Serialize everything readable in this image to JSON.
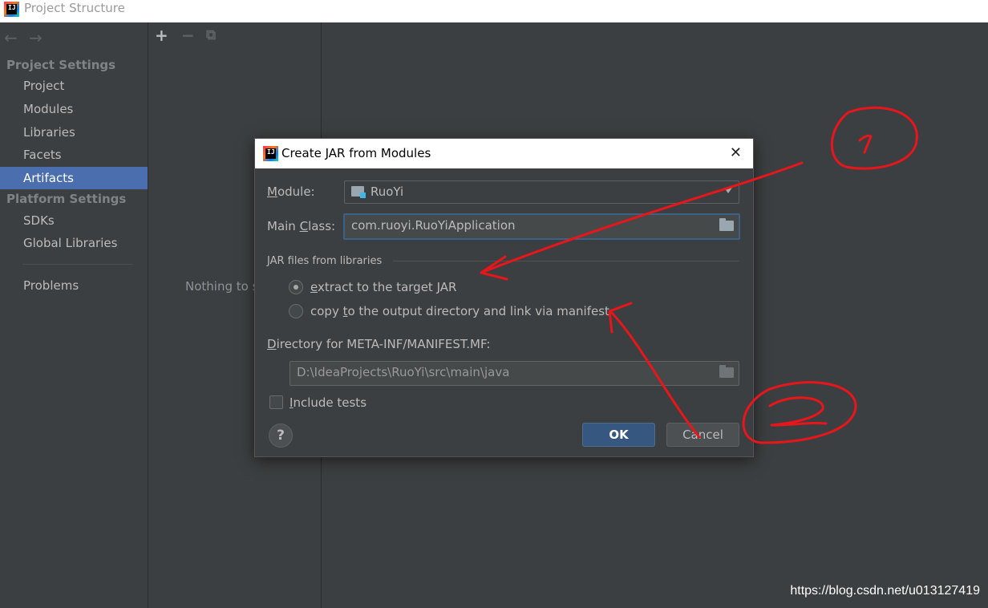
{
  "window": {
    "title": "Project Structure",
    "app_icon_text": "IJ"
  },
  "nav": {
    "back_icon": "←",
    "forward_icon": "→",
    "project_settings_title": "Project Settings",
    "project_items": [
      "Project",
      "Modules",
      "Libraries",
      "Facets",
      "Artifacts"
    ],
    "selected": "Artifacts",
    "platform_settings_title": "Platform Settings",
    "platform_items": [
      "SDKs",
      "Global Libraries"
    ],
    "problems": "Problems"
  },
  "toolbar": {
    "add": "+",
    "remove": "−",
    "copy": "⧉"
  },
  "middle": {
    "empty_text": "Nothing to s"
  },
  "dialog": {
    "title": "Create JAR from Modules",
    "close": "✕",
    "module_label_u": "M",
    "module_label_rest": "odule:",
    "module_value": "RuoYi",
    "main_class_label_pre": "Main ",
    "main_class_label_u": "C",
    "main_class_label_post": "lass:",
    "main_class_value": "com.ruoyi.RuoYiApplication",
    "jar_group_title": "JAR files from libraries",
    "option_extract_u": "e",
    "option_extract_rest": "xtract to the target JAR",
    "option_copy_pre": "copy ",
    "option_copy_u": "t",
    "option_copy_post": "o the output directory and link via manifest",
    "selected_option": "extract",
    "manifest_label_u": "D",
    "manifest_label_rest": "irectory for META-INF/MANIFEST.MF:",
    "manifest_value": "D:\\IdeaProjects\\RuoYi\\src\\main\\java",
    "include_tests_u": "I",
    "include_tests_rest": "nclude tests",
    "include_tests_checked": false,
    "help": "?",
    "ok": "OK",
    "cancel": "Cancel"
  },
  "annotations": {
    "marker_1": "1",
    "marker_2": "2",
    "color": "#e8161b"
  },
  "watermark": "https://blog.csdn.net/u013127419"
}
